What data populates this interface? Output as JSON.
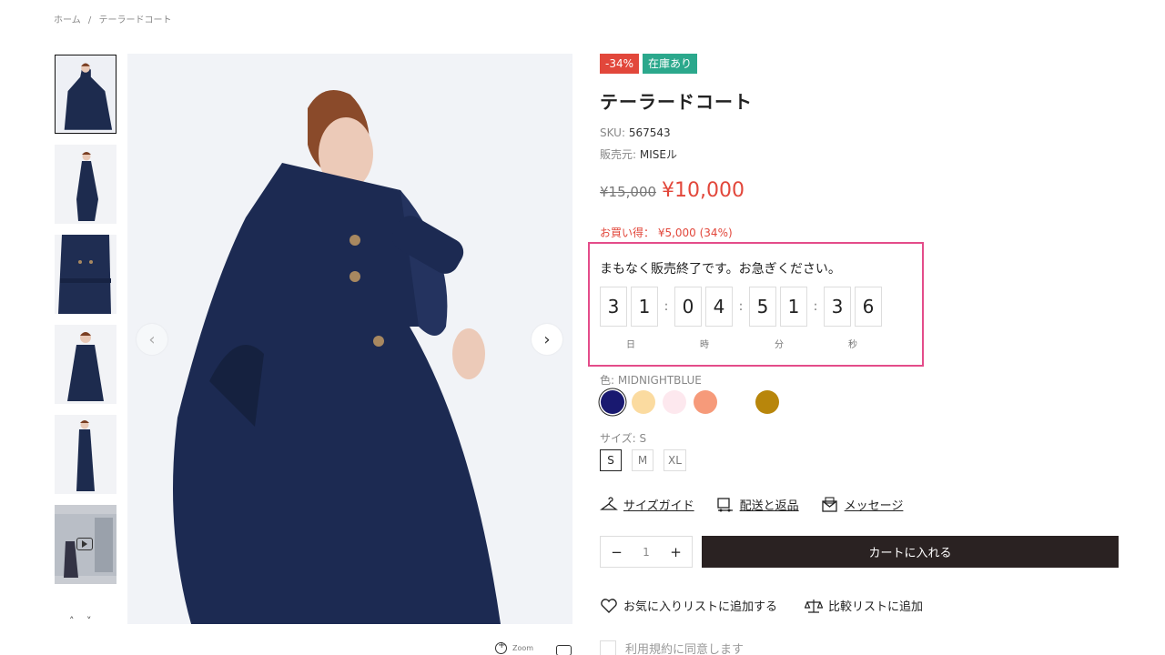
{
  "breadcrumb": {
    "home": "ホーム",
    "sep": "/",
    "current": "テーラードコート"
  },
  "gallery": {
    "thumbnails": [
      "coat-front-open",
      "coat-side",
      "coat-belt-detail",
      "coat-double-breasted",
      "coat-full-length",
      "coat-video"
    ],
    "thumb_nav_up": "˄",
    "thumb_nav_down": "˅",
    "prev_icon": "‹",
    "next_icon": "›",
    "zoom_label": "Zoom"
  },
  "product": {
    "badge_sale": "-34%",
    "badge_stock": "在庫あり",
    "title": "テーラードコート",
    "sku_label": "SKU:",
    "sku_value": "567543",
    "vendor_label": "販売元:",
    "vendor_value": "MISEル",
    "old_price": "¥15,000",
    "new_price": "¥10,000",
    "savings": "お買い得： ¥5,000 (34%)"
  },
  "countdown": {
    "message": "まもなく販売終了です。お急ぎください。",
    "days": [
      "3",
      "1"
    ],
    "hours": [
      "0",
      "4"
    ],
    "minutes": [
      "5",
      "1"
    ],
    "seconds": [
      "3",
      "6"
    ],
    "separator": ":",
    "unit_days": "日",
    "unit_hours": "時",
    "unit_minutes": "分",
    "unit_seconds": "秒"
  },
  "color": {
    "label": "色:",
    "selected": "MIDNIGHTBLUE",
    "swatches": [
      "#191970",
      "#fbdba0",
      "#fde8ee",
      "#f69a7a",
      "#ffffff",
      "#b8860b"
    ]
  },
  "size": {
    "label": "サイズ:",
    "selected": "S",
    "options": [
      "S",
      "M",
      "XL"
    ]
  },
  "links": {
    "size_guide": "サイズガイド",
    "shipping": "配送と返品",
    "message": "メッセージ"
  },
  "cart": {
    "minus": "−",
    "quantity": "1",
    "plus": "+",
    "add_label": "カートに入れる"
  },
  "wishlist_label": "お気に入りリストに追加する",
  "compare_label": "比較リストに追加",
  "terms_label": "利用規約に同意します"
}
